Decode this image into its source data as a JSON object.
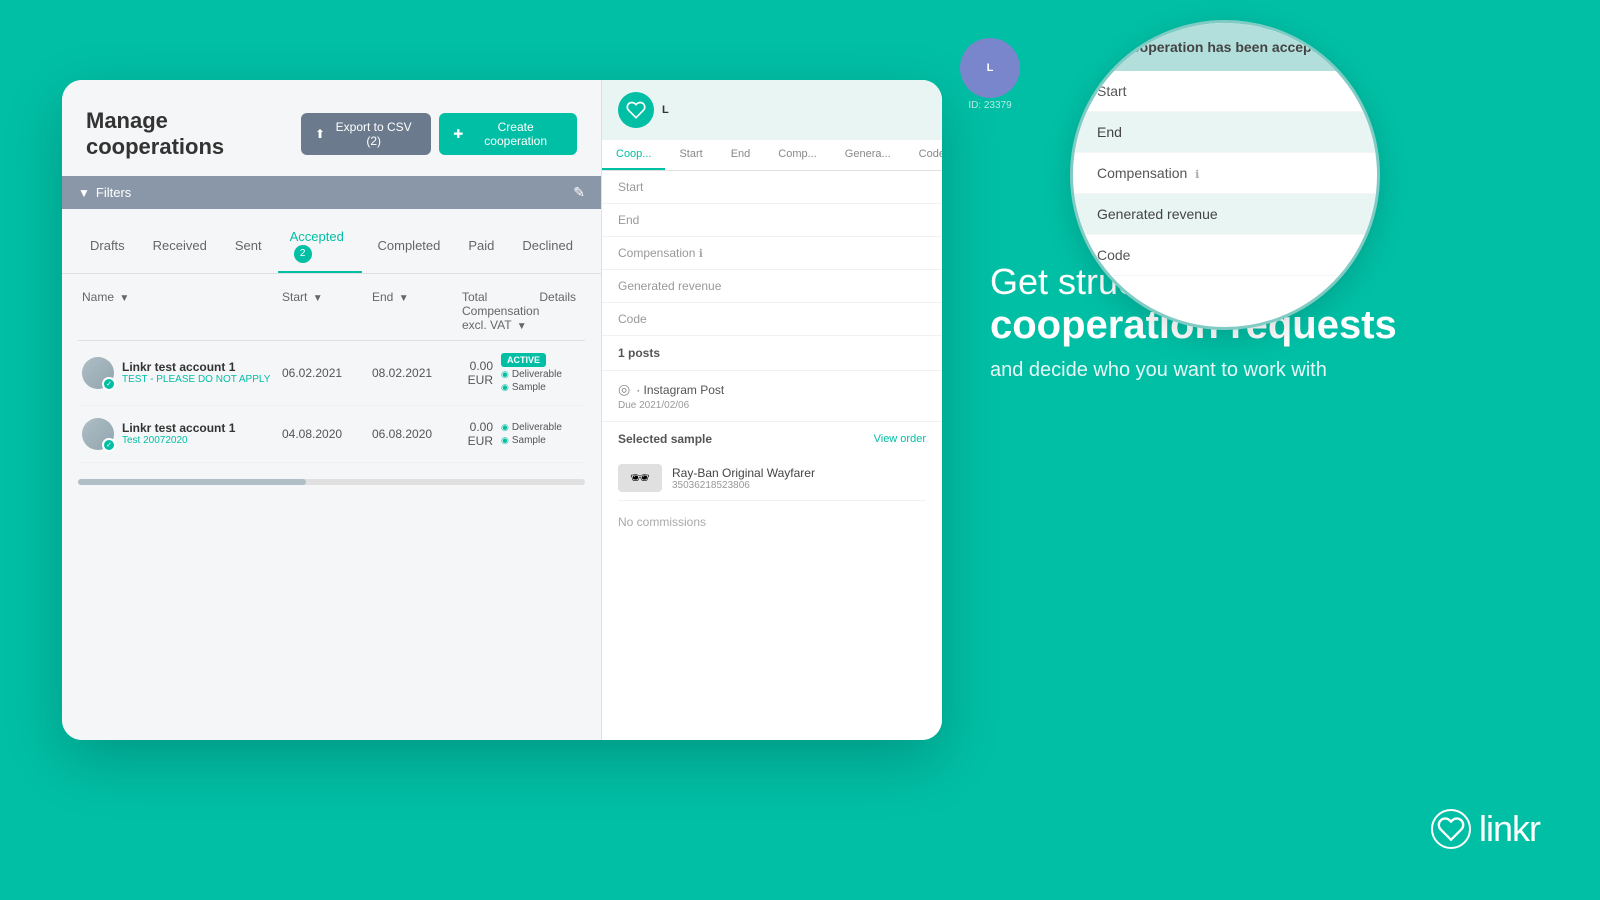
{
  "background_color": "#00BFA5",
  "page_title": "Manage cooperations",
  "header": {
    "title": "Manage cooperations",
    "export_btn": "Export to CSV (2)",
    "create_btn": "Create cooperation",
    "filters_label": "Filters"
  },
  "tabs": [
    {
      "label": "Drafts",
      "active": false
    },
    {
      "label": "Received",
      "active": false
    },
    {
      "label": "Sent",
      "active": false
    },
    {
      "label": "Accepted",
      "active": true,
      "badge": "2"
    },
    {
      "label": "Completed",
      "active": false
    },
    {
      "label": "Paid",
      "active": false
    },
    {
      "label": "Declined",
      "active": false
    }
  ],
  "table": {
    "headers": [
      "Name",
      "Start",
      "End",
      "Total Compensation excl. VAT",
      "Details"
    ],
    "rows": [
      {
        "name": "Linkr test account 1",
        "sub": "TEST - PLEASE DO NOT APPLY",
        "start": "06.02.2021",
        "end": "08.02.2021",
        "amount": "0.00 EUR",
        "tag": "ACTIVE",
        "detail1": "Deliverable",
        "detail2": "Sample"
      },
      {
        "name": "Linkr test account 1",
        "sub": "Test 20072020",
        "start": "04.08.2020",
        "end": "06.08.2020",
        "amount": "0.00 EUR",
        "tag": null,
        "detail1": "Deliverable",
        "detail2": "Sample"
      }
    ]
  },
  "right_panel": {
    "id": "ID: 23379",
    "coop_tabs": [
      "Coop...",
      "Start",
      "End",
      "Comp...",
      "Genera...",
      "Code"
    ],
    "info_rows": [
      {
        "label": "Start",
        "value": ""
      },
      {
        "label": "End",
        "value": ""
      },
      {
        "label": "Compensation",
        "value": ""
      },
      {
        "label": "Generated revenue",
        "value": ""
      },
      {
        "label": "Code",
        "value": ""
      }
    ],
    "posts_count": "1 posts",
    "instagram_post": {
      "label": "Instagram Post",
      "due": "Due 2021/02/06"
    },
    "selected_sample": "Selected sample",
    "view_order": "View order",
    "product": {
      "name": "Ray-Ban Original Wayfarer",
      "sku": "35036218523806"
    },
    "no_commissions": "No commissions"
  },
  "circle_overlay": {
    "title": "Cooperation has been accepted",
    "menu_items": [
      "Start",
      "End",
      "Compensation",
      "Generated revenue",
      "Code"
    ]
  },
  "tagline": {
    "line1": "Get structured",
    "line2": "cooperation requests",
    "line3": "and decide who you want to work with"
  },
  "logo": {
    "text": "linkr"
  }
}
